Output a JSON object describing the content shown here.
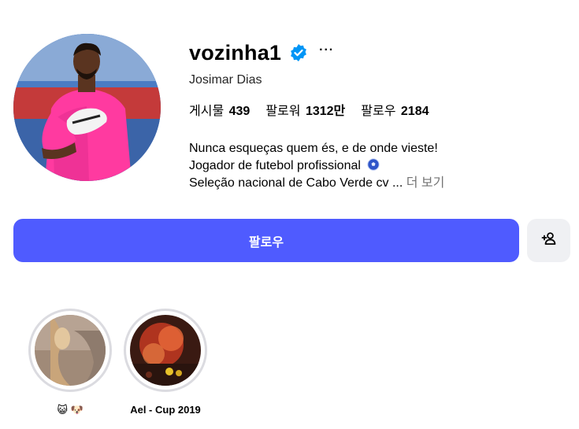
{
  "profile": {
    "username": "vozinha1",
    "verified": true,
    "more_label": "···",
    "full_name": "Josimar Dias",
    "stats": {
      "posts_label": "게시물",
      "posts_value": "439",
      "followers_label": "팔로워",
      "followers_value": "1312만",
      "following_label": "팔로우",
      "following_value": "2184"
    },
    "bio": {
      "line1": "Nunca esqueças quem és, e de onde vieste!",
      "line2": "Jogador de futebol profissional",
      "line3": "Seleção nacional de Cabo Verde cv ...",
      "more_link": "더 보기"
    }
  },
  "actions": {
    "follow_label": "팔로우",
    "suggest_icon": "add-person-icon"
  },
  "highlights": [
    {
      "label": "😺 🐶",
      "icon": "highlight-cover"
    },
    {
      "label": "Ael - Cup 2019",
      "icon": "highlight-cover"
    }
  ],
  "colors": {
    "accent": "#4f5bff",
    "verified": "#0095f6",
    "secondary_button": "#eff0f3",
    "muted_text": "#737373"
  }
}
